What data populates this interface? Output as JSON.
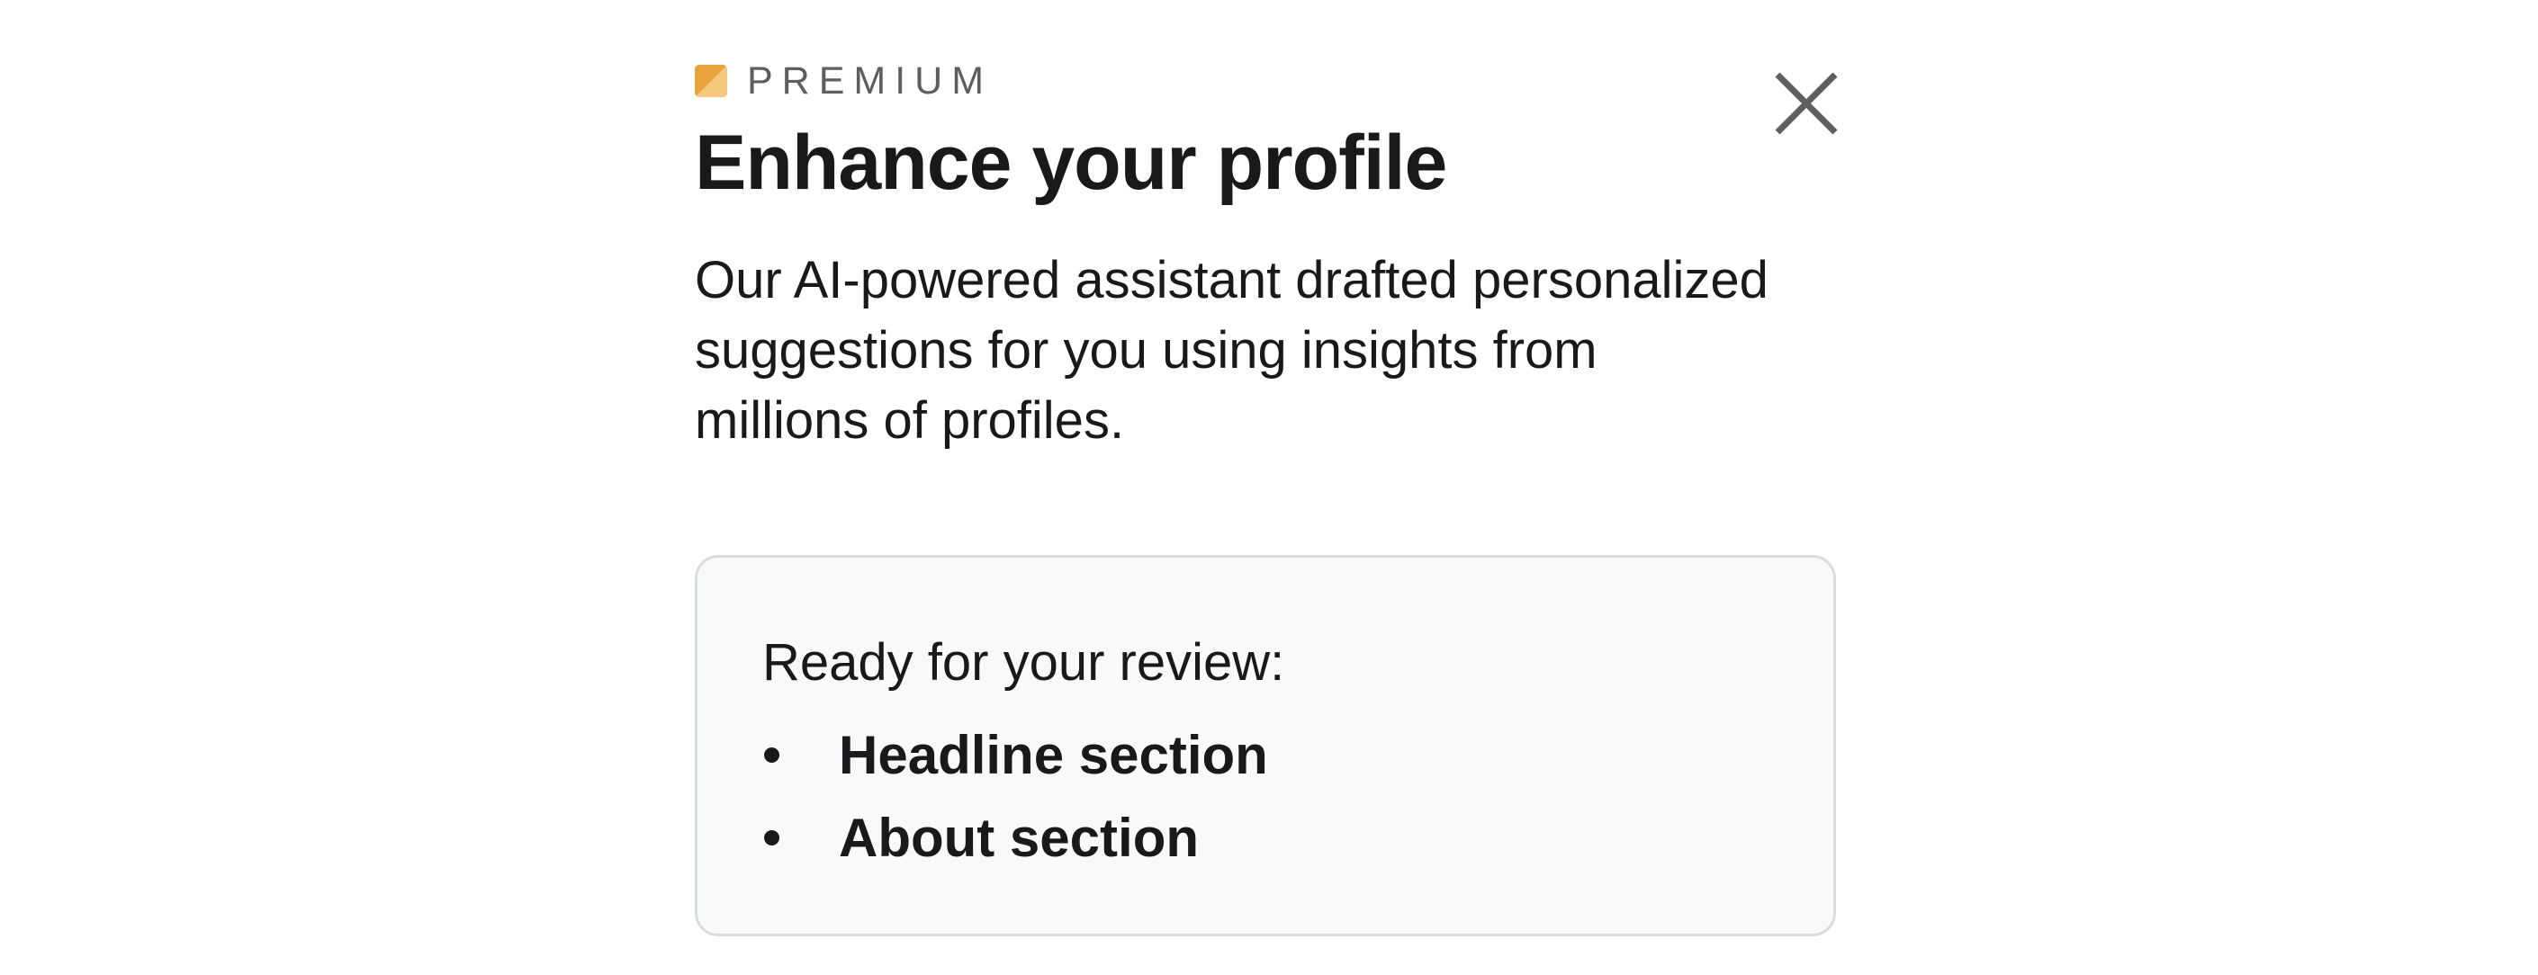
{
  "header": {
    "badge_label": "PREMIUM",
    "badge_icon": "premium-icon",
    "close_icon": "close-icon"
  },
  "title": "Enhance your profile",
  "description": "Our AI-powered assistant drafted personalized suggestions for you using insights from millions of profiles.",
  "review_card": {
    "heading": "Ready for your review:",
    "items": [
      {
        "label": "Headline section"
      },
      {
        "label": "About section"
      }
    ]
  },
  "colors": {
    "premium_gold": "#e7a33e",
    "premium_gold_light": "#f8c77e",
    "card_background": "#f8f9fb",
    "card_border": "#dcdcdc",
    "muted_text": "#5e5e5e"
  }
}
